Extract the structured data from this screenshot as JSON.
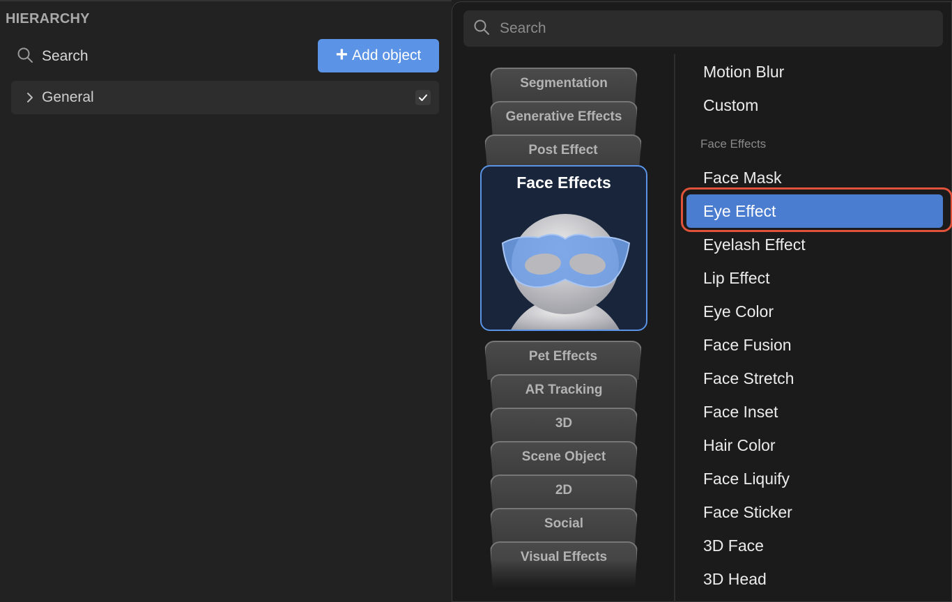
{
  "hierarchy": {
    "title": "HIERARCHY",
    "search_label": "Search",
    "add_button": "Add object",
    "rows": [
      {
        "label": "General",
        "checked": true
      }
    ]
  },
  "popup": {
    "search_placeholder": "Search",
    "categories_above": [
      "Segmentation",
      "Generative Effects",
      "Post Effect"
    ],
    "active_category": "Face Effects",
    "categories_below": [
      "Pet Effects",
      "AR Tracking",
      "3D",
      "Scene Object",
      "2D",
      "Social",
      "Visual Effects"
    ],
    "list_top": [
      "Motion Blur",
      "Custom"
    ],
    "section_header": "Face Effects",
    "list_items": [
      "Face Mask",
      "Eye Effect",
      "Eyelash Effect",
      "Lip Effect",
      "Eye Color",
      "Face Fusion",
      "Face Stretch",
      "Face Inset",
      "Hair Color",
      "Face Liquify",
      "Face Sticker",
      "3D Face",
      "3D Head"
    ],
    "selected_item": "Eye Effect"
  },
  "colors": {
    "accent": "#5b93e6",
    "selected_row": "#4a7dd0",
    "highlight_ring": "#e0533a",
    "background": "#1f1f1f"
  },
  "icons": [
    "search-icon",
    "plus-icon",
    "chevron-right-icon",
    "checkmark-icon",
    "face-mask-icon"
  ]
}
